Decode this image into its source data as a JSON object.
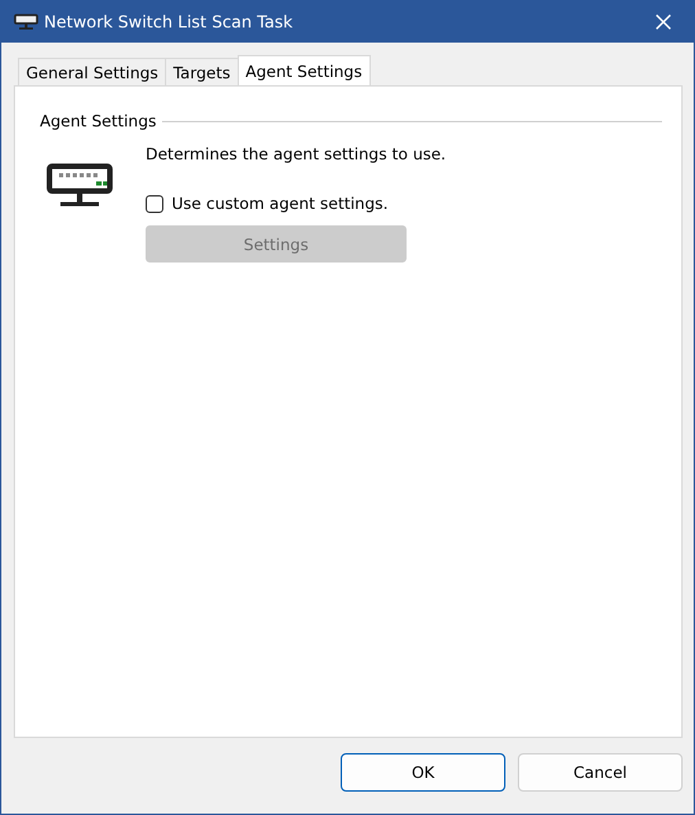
{
  "window": {
    "title": "Network Switch List Scan Task"
  },
  "tabs": [
    {
      "label": "General Settings",
      "selected": false
    },
    {
      "label": "Targets",
      "selected": false
    },
    {
      "label": "Agent Settings",
      "selected": true
    }
  ],
  "group": {
    "title": "Agent Settings",
    "description": "Determines the agent settings to use.",
    "checkbox": {
      "label": "Use custom agent settings.",
      "checked": false
    },
    "settings_button": {
      "label": "Settings",
      "disabled": true
    }
  },
  "buttons": [
    {
      "label": "OK",
      "kind": "default"
    },
    {
      "label": "Cancel",
      "kind": "normal"
    }
  ]
}
